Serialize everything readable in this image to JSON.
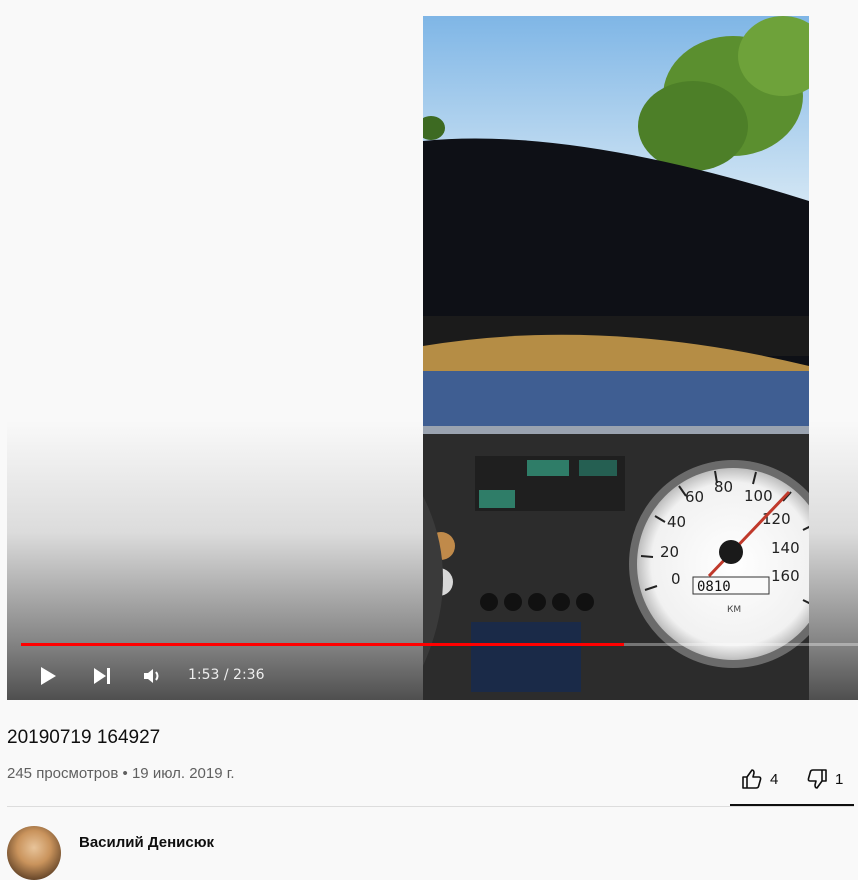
{
  "player": {
    "progress_fraction": 0.72,
    "time_display": "1:53 / 2:36",
    "controls": {
      "play_icon": "play-icon",
      "next_icon": "next-icon",
      "volume_icon": "volume-icon"
    },
    "accent_color": "#ff0000",
    "speedometer": {
      "scale_labels": [
        "0",
        "20",
        "40",
        "60",
        "80",
        "100",
        "120",
        "140",
        "160"
      ],
      "odometer": "0810",
      "unit": "КМ"
    }
  },
  "video": {
    "title": "20190719 164927",
    "views": "245 просмотров",
    "separator": "•",
    "date": "19 июл. 2019 г.",
    "likes": "4",
    "dislikes": "1"
  },
  "channel": {
    "name": "Василий Денисюк"
  }
}
